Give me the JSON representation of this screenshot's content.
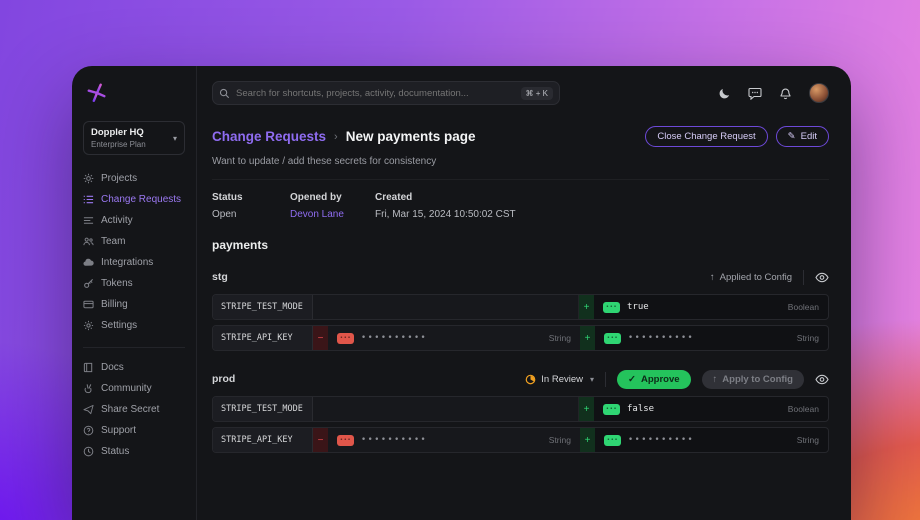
{
  "colors": {
    "accent_purple": "#8f6cf0",
    "green": "#24c35c",
    "red": "#e5484d",
    "orange": "#f0a021"
  },
  "icons": {
    "plus": "+",
    "minus": "−",
    "arrow_up": "↑",
    "chevron_down": "▾",
    "check": "✓",
    "edit": "✎"
  },
  "sidebar": {
    "workspace_name": "Doppler HQ",
    "workspace_plan": "Enterprise Plan",
    "nav": [
      {
        "label": "Projects",
        "icon": "projects-icon"
      },
      {
        "label": "Change Requests",
        "icon": "change-requests-icon",
        "active": true
      },
      {
        "label": "Activity",
        "icon": "activity-icon"
      },
      {
        "label": "Team",
        "icon": "team-icon"
      },
      {
        "label": "Integrations",
        "icon": "integrations-icon"
      },
      {
        "label": "Tokens",
        "icon": "tokens-icon"
      },
      {
        "label": "Billing",
        "icon": "billing-icon"
      },
      {
        "label": "Settings",
        "icon": "settings-icon"
      }
    ],
    "secondary": [
      {
        "label": "Docs",
        "icon": "docs-icon"
      },
      {
        "label": "Community",
        "icon": "community-icon"
      },
      {
        "label": "Share Secret",
        "icon": "share-secret-icon"
      },
      {
        "label": "Support",
        "icon": "support-icon"
      },
      {
        "label": "Status",
        "icon": "status-icon"
      }
    ]
  },
  "topbar": {
    "search_placeholder": "Search for shortcuts, projects, activity, documentation...",
    "shortcut": "⌘ + K"
  },
  "header": {
    "breadcrumb": "Change Requests",
    "separator": "›",
    "title": "New payments page",
    "subtitle": "Want to update / add these secrets for consistency",
    "close_button": "Close Change Request",
    "edit_button": "Edit"
  },
  "meta": {
    "status_label": "Status",
    "status_value": "Open",
    "opened_by_label": "Opened by",
    "opened_by_value": "Devon Lane",
    "created_label": "Created",
    "created_value": "Fri, Mar 15, 2024 10:50:02 CST"
  },
  "project_name": "payments",
  "masked_badge": "•••",
  "configs": {
    "stg": {
      "name": "stg",
      "applied_text": "Applied to Config",
      "rows": [
        {
          "key": "STRIPE_TEST_MODE",
          "new_value": "true",
          "type": "Boolean"
        },
        {
          "key": "STRIPE_API_KEY",
          "old_value": "••••••••••",
          "old_type": "String",
          "new_value": "••••••••••",
          "new_type": "String"
        }
      ]
    },
    "prod": {
      "name": "prod",
      "review_label": "In Review",
      "approve_label": "Approve",
      "apply_label": "Apply to Config",
      "rows": [
        {
          "key": "STRIPE_TEST_MODE",
          "new_value": "false",
          "type": "Boolean"
        },
        {
          "key": "STRIPE_API_KEY",
          "old_value": "••••••••••",
          "old_type": "String",
          "new_value": "••••••••••",
          "new_type": "String"
        }
      ]
    }
  }
}
